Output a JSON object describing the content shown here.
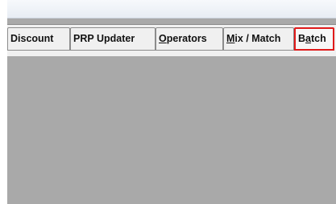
{
  "tabs": {
    "discount": "Discount",
    "prp_updater": "PRP Updater",
    "operators": {
      "mnemonic": "O",
      "rest": "perators"
    },
    "mix_match": {
      "mnemonic": "M",
      "rest": "ix / Match"
    },
    "batch": {
      "before": "B",
      "mnemonic": "a",
      "after": "tch"
    }
  },
  "colors": {
    "selected_tab_border": "#e01a1a",
    "content_background": "#a9a9a9",
    "tab_background": "#f0f0f0"
  }
}
